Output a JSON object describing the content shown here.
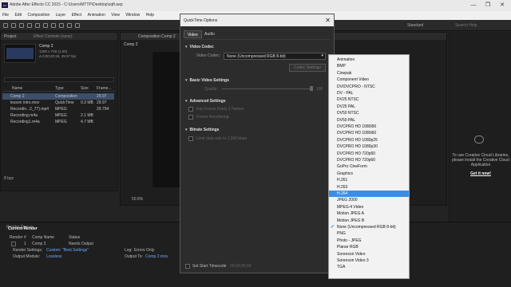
{
  "window": {
    "title": "Adobe After Effects CC 2015 - C:\\Users\\MTTP\\Desktop\\sqft.aep",
    "min_label": "—",
    "max_label": "❐",
    "close_label": "✕"
  },
  "menu": [
    "File",
    "Edit",
    "Composition",
    "Layer",
    "Effect",
    "Animation",
    "View",
    "Window",
    "Help"
  ],
  "toolbar": {
    "workspace": "Standard",
    "search_placeholder": "Search Help"
  },
  "project_panel": {
    "tab_label": "Project",
    "effect_controls_label": "Effect Controls (none)",
    "selected_name": "Comp 2",
    "selected_details": "1280 x 720 (1.00)",
    "selected_duration": "Δ 0;00;20;18, 29.97 fps",
    "columns": [
      "Name",
      "Type",
      "Size",
      "Frame..."
    ],
    "items": [
      {
        "name": "Comp 2",
        "type": "Composition",
        "size": "",
        "fps": "29.97"
      },
      {
        "name": "lesson intro.mov",
        "type": "QuickTime",
        "size": "9.3 MB",
        "fps": "29.97"
      },
      {
        "name": "Recordin...2_77).mp4",
        "type": "MPEG",
        "size": "",
        "fps": "29.794"
      },
      {
        "name": "Recording.m4a",
        "type": "MPEG",
        "size": "2.1 MB",
        "fps": ""
      },
      {
        "name": "Recording1.m4a",
        "type": "MPEG",
        "size": "4.7 MB",
        "fps": ""
      }
    ],
    "bpc": "8 bpc"
  },
  "comp_panel": {
    "tab_label": "Composition Comp 2",
    "sub_tab": "Comp 2",
    "zoom": "50.8%"
  },
  "dialog": {
    "title": "QuickTime Options",
    "close_label": "✕",
    "tabs": [
      "Video",
      "Audio"
    ],
    "video_codec_section": "Video Codec",
    "video_codec_label": "Video Codec:",
    "video_codec_value": "None (Uncompressed RGB 8-bit)",
    "codec_settings_button": "Codec Settings",
    "basic_video_section": "Basic Video Settings",
    "quality_label": "Quality:",
    "quality_value": "100",
    "advanced_section": "Advanced Settings",
    "key_frame_label": "Key Frame Every  1  frames",
    "frame_reordering_label": "Frame Reordering",
    "bitrate_section": "Bitrate Settings",
    "limit_data_rate_label": "Limit data rate to  1,000  kbps",
    "set_start_timecode_label": "Set Start Timecode",
    "start_timecode_value": "00;00;00;00"
  },
  "codec_dropdown": {
    "selected": "None (Uncompressed RGB 8-bit)",
    "highlighted": "H.264",
    "options": [
      "Animation",
      "BMP",
      "Cinepak",
      "Component Video",
      "DV/DVCPRO - NTSC",
      "DV - PAL",
      "DV25 NTSC",
      "DV25 PAL",
      "DV50 NTSC",
      "DV50 PAL",
      "DVCPRO HD 1080i50",
      "DVCPRO HD 1080i60",
      "DVCPRO HD 1080p25",
      "DVCPRO HD 1080p30",
      "DVCPRO HD 720p50",
      "DVCPRO HD 720p60",
      "GoPro CineForm",
      "Graphics",
      "H.261",
      "H.263",
      "H.264",
      "JPEG 2000",
      "MPEG-4 Video",
      "Motion JPEG A",
      "Motion JPEG B",
      "None (Uncompressed RGB 8-bit)",
      "PNG",
      "Photo - JPEG",
      "Planar RGB",
      "Sorenson Video",
      "Sorenson Video 3",
      "TGA"
    ]
  },
  "libraries_panel": {
    "message": "To use Creative Cloud Libraries, please install the Creative Cloud Application",
    "link": "Get it now!"
  },
  "render_queue": {
    "tab_label": "Render Queue",
    "current_render": "Current Render",
    "columns": [
      "Render",
      "#",
      "Comp Name",
      "Status"
    ],
    "row": {
      "num": "1",
      "comp": "Comp 2",
      "status": "Needs Output"
    },
    "render_settings_label": "Render Settings:",
    "render_settings_value": "Custom: \"Best Settings\"",
    "output_module_label": "Output Module:",
    "output_module_value": "Lossless",
    "log_label": "Log:",
    "log_value": "Errors Only",
    "output_to_label": "Output To:",
    "output_to_value": "Comp 2.mov"
  },
  "colors": {
    "accent_blue": "#3a8ee6",
    "dialog_bg": "#2c2c2c",
    "app_bg": "#232323"
  }
}
